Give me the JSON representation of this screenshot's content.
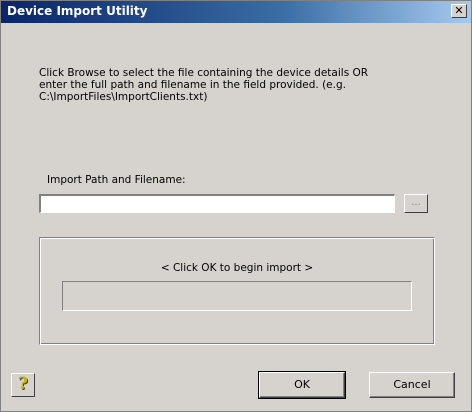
{
  "window": {
    "title": "Device Import Utility",
    "close_glyph": "✕"
  },
  "instructions": {
    "line1": "Click Browse to select the file containing  the device details OR",
    "line2": "enter the full path and filename in the field provided. (e.g.",
    "line3": "C:\\ImportFiles\\ImportClients.txt)"
  },
  "path": {
    "label": "Import Path and Filename:",
    "value": "",
    "placeholder": ""
  },
  "browse": {
    "label": "..."
  },
  "import_panel": {
    "status": "< Click OK to begin import >",
    "progress_fraction": 0
  },
  "buttons": {
    "help_glyph": "?",
    "ok_label": "OK",
    "cancel_label": "Cancel"
  },
  "colors": {
    "titlebar_start": "#0a246a",
    "titlebar_end": "#a6caf0",
    "face": "#d6d3ce",
    "help_icon": "#c8b400"
  }
}
